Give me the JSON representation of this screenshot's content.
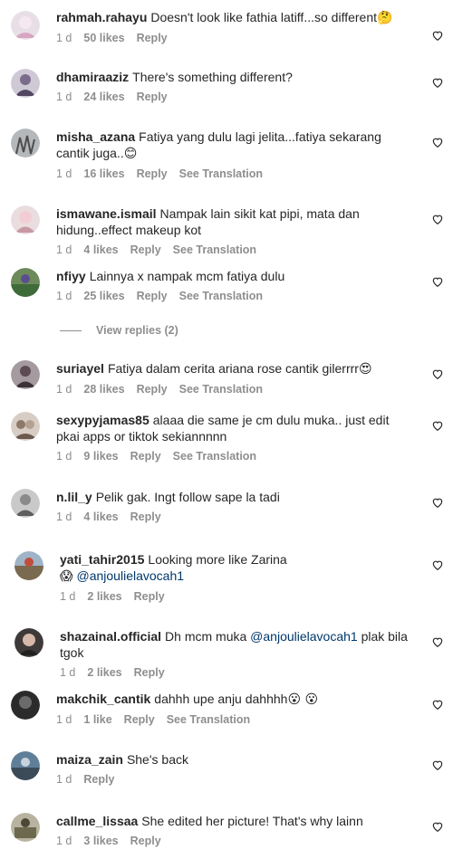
{
  "comments": [
    {
      "user": "rahmah.rahayu",
      "text": "Doesn't look like fathia latiff...so different",
      "emoji": "🤔",
      "time": "1 d",
      "likes": "50 likes",
      "reply": "Reply",
      "translate": ""
    },
    {
      "user": "dhamiraaziz",
      "text": "There's something different?",
      "emoji": "",
      "time": "1 d",
      "likes": "24 likes",
      "reply": "Reply",
      "translate": ""
    },
    {
      "user": "misha_azana",
      "text": "Fatiya yang dulu lagi jelita...fatiya sekarang cantik juga..",
      "emoji": "😊",
      "time": "1 d",
      "likes": "16 likes",
      "reply": "Reply",
      "translate": "See Translation"
    },
    {
      "user": "ismawane.ismail",
      "text": "Nampak lain sikit kat pipi, mata dan hidung..effect makeup kot",
      "emoji": "",
      "time": "1 d",
      "likes": "4 likes",
      "reply": "Reply",
      "translate": "See Translation"
    },
    {
      "user": "nfiyy",
      "text": "Lainnya x nampak mcm fatiya dulu",
      "emoji": "",
      "time": "1 d",
      "likes": "25 likes",
      "reply": "Reply",
      "translate": "See Translation"
    },
    {
      "user": "suriayel",
      "text": "Fatiya dalam cerita ariana rose cantik gilerrrr",
      "emoji": "😍",
      "time": "1 d",
      "likes": "28 likes",
      "reply": "Reply",
      "translate": "See Translation"
    },
    {
      "user": "sexypyjamas85",
      "text": "alaaa die same je cm dulu muka.. just edit pkai apps or tiktok sekiannnnn",
      "emoji": "",
      "time": "1 d",
      "likes": "9 likes",
      "reply": "Reply",
      "translate": "See Translation"
    },
    {
      "user": "n.lil_y",
      "text": "Pelik gak. Ingt follow sape la tadi",
      "emoji": "",
      "time": "1 d",
      "likes": "4 likes",
      "reply": "Reply",
      "translate": ""
    },
    {
      "user": "yati_tahir2015",
      "text": "Looking more like Zarina",
      "emoji": "😱",
      "mention": "@anjoulielavocah1",
      "time": "1 d",
      "likes": "2 likes",
      "reply": "Reply",
      "translate": ""
    },
    {
      "user": "shazainal.official",
      "text": "Dh mcm muka",
      "mention": "@anjoulielavocah1",
      "text_after": "plak bila tgok",
      "emoji": "",
      "time": "1 d",
      "likes": "2 likes",
      "reply": "Reply",
      "translate": ""
    },
    {
      "user": "makchik_cantik",
      "text": "dahhh upe anju dahhhh",
      "emoji": "😮 😮",
      "time": "1 d",
      "likes": "1 like",
      "reply": "Reply",
      "translate": "See Translation"
    },
    {
      "user": "maiza_zain",
      "text": "She's back",
      "emoji": "",
      "time": "1 d",
      "likes": "",
      "reply": "Reply",
      "translate": ""
    },
    {
      "user": "callme_lissaa",
      "text": "She edited her picture! That's why lainn",
      "emoji": "",
      "time": "1 d",
      "likes": "3 likes",
      "reply": "Reply",
      "translate": ""
    }
  ],
  "view_replies": "View replies (2)",
  "colors": {
    "text": "#262626",
    "meta": "#8e8e8e",
    "mention": "#00376b"
  }
}
